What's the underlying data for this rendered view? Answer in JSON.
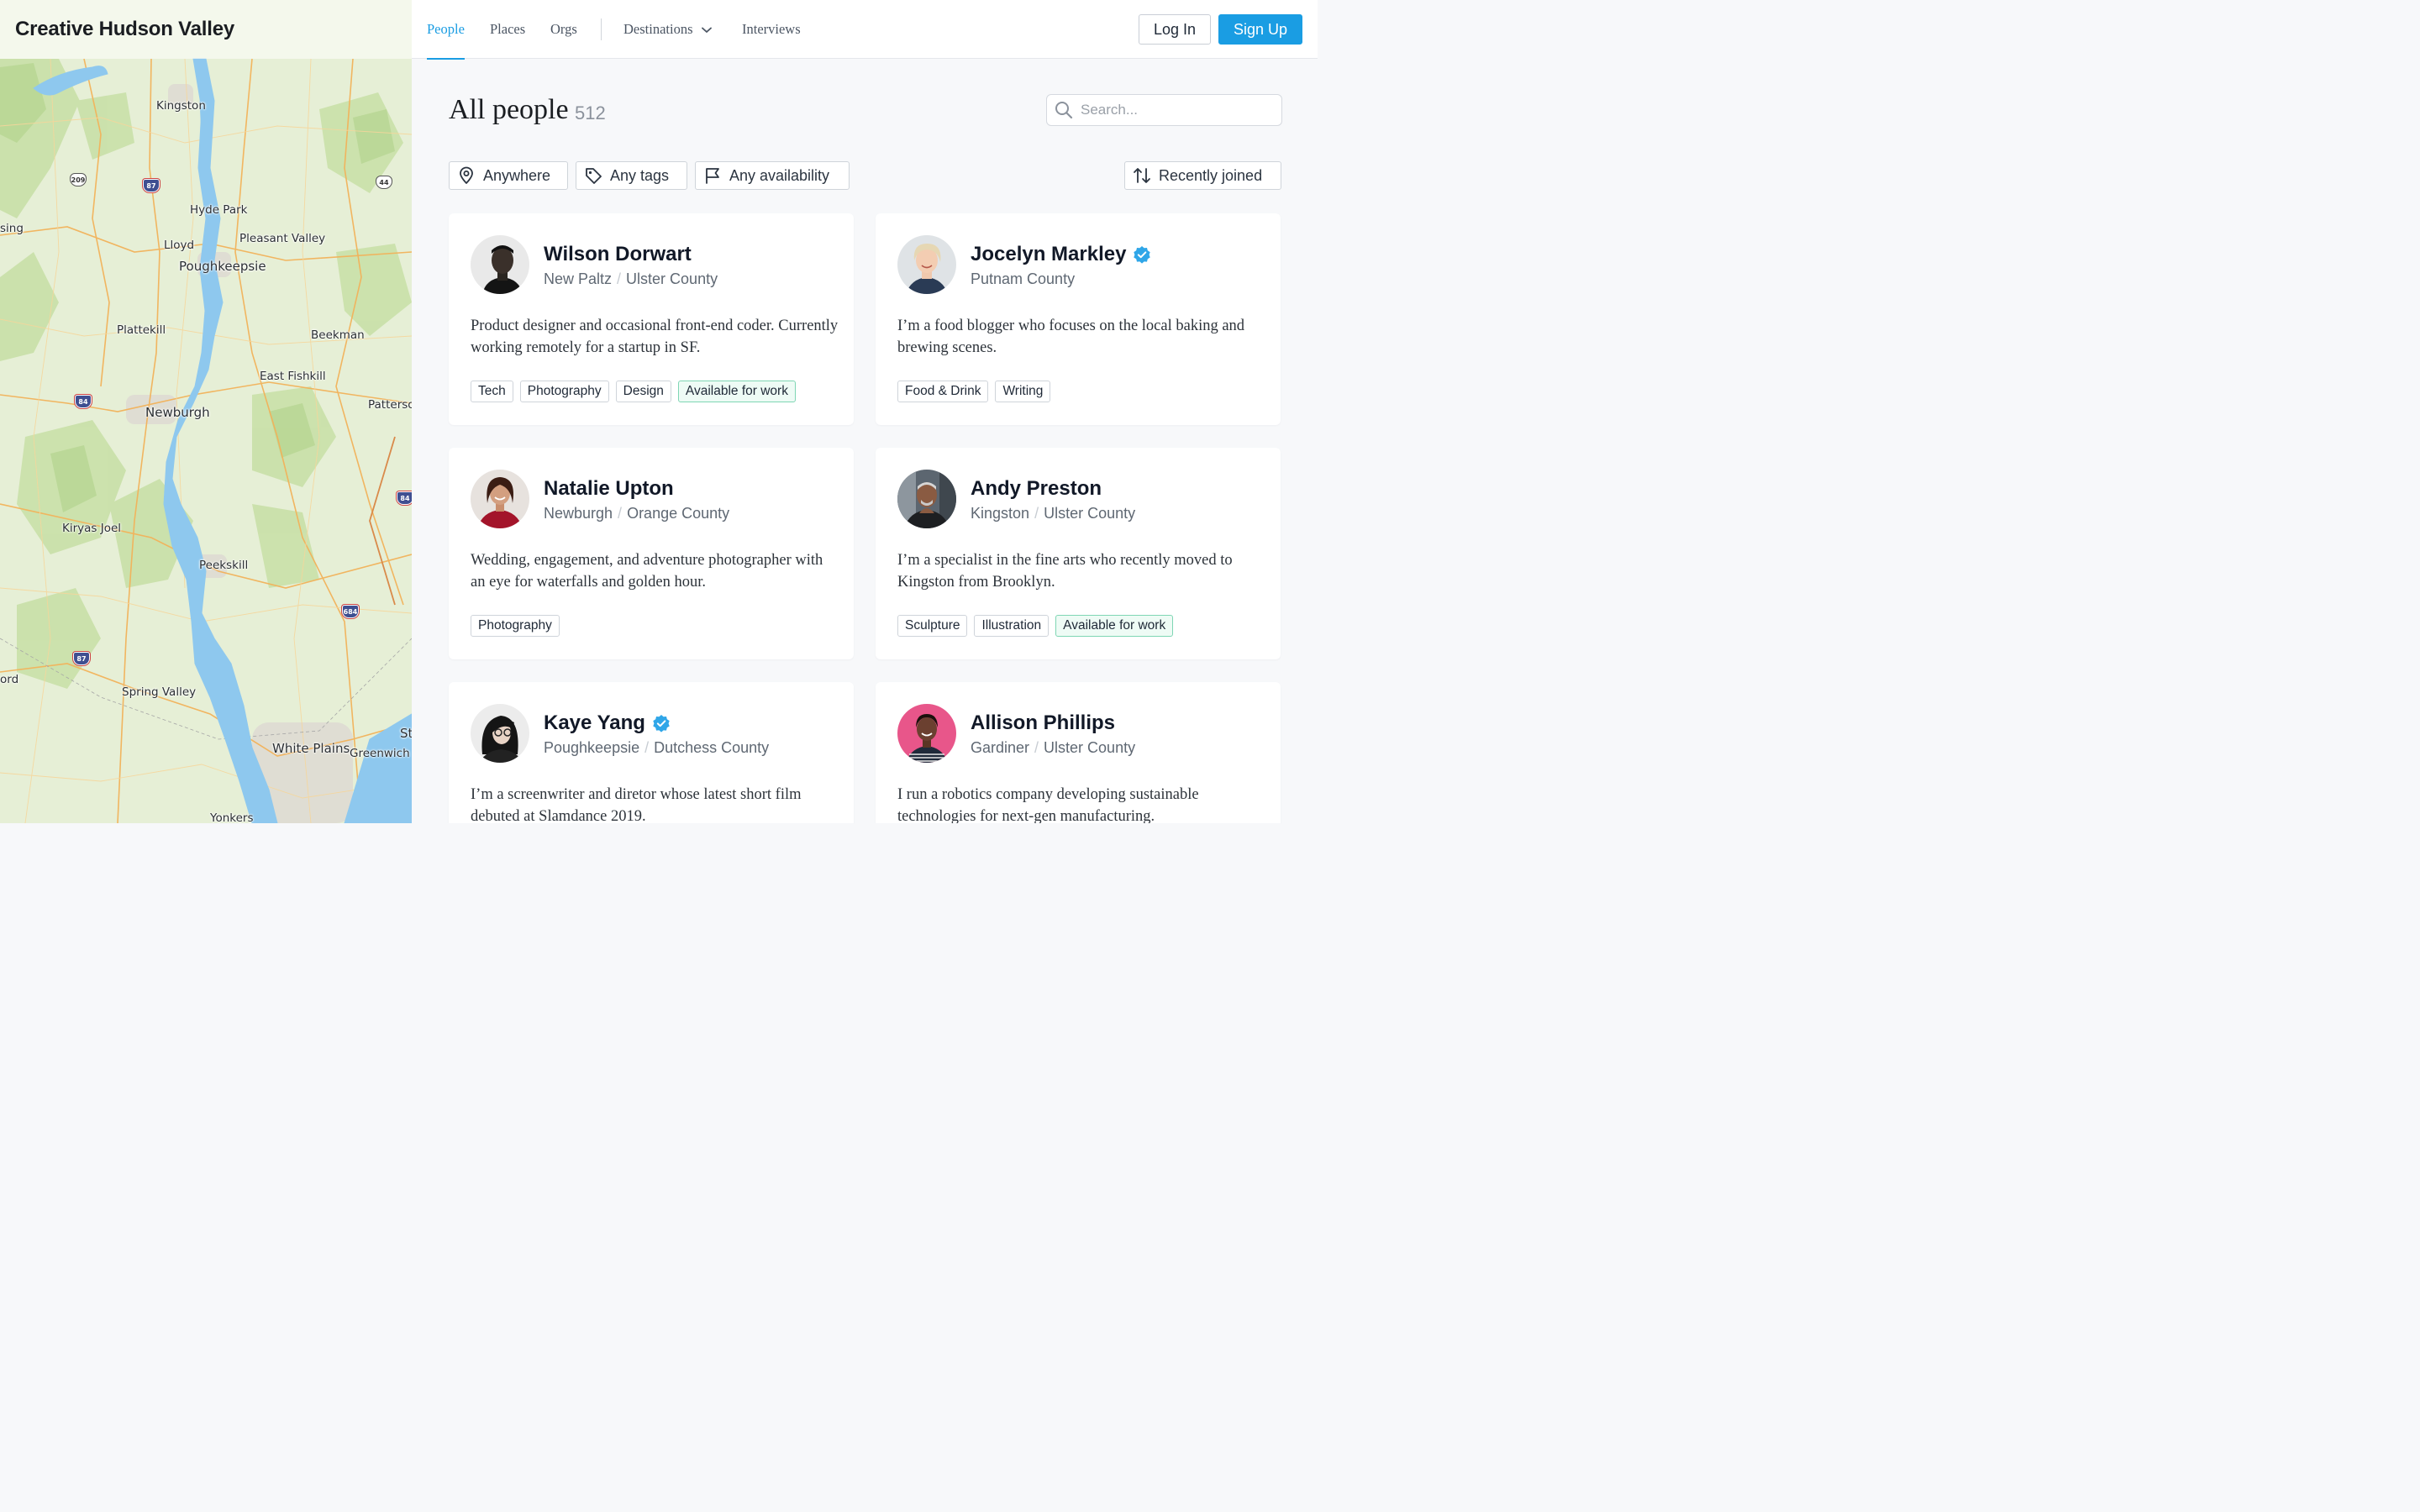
{
  "brand": {
    "title": "Creative Hudson Valley"
  },
  "nav": {
    "items": [
      "People",
      "Places",
      "Orgs"
    ],
    "destinations_label": "Destinations",
    "interviews_label": "Interviews",
    "login_label": "Log In",
    "signup_label": "Sign Up"
  },
  "page": {
    "title": "All people",
    "count": "512"
  },
  "search": {
    "placeholder": "Search...",
    "value": ""
  },
  "filters": {
    "location": "Anywhere",
    "tags": "Any tags",
    "availability": "Any availability",
    "sort": "Recently joined"
  },
  "map": {
    "labels": {
      "kingston": "Kingston",
      "hyde_park": "Hyde Park",
      "lloyd": "Lloyd",
      "pleasant_valley": "Pleasant Valley",
      "poughkeepsie": "Poughkeepsie",
      "plattekill": "Plattekill",
      "beekman": "Beekman",
      "east_fishkill": "East Fishkill",
      "newburgh": "Newburgh",
      "patterson": "Patterso",
      "kiryas_joel": "Kiryas Joel",
      "peekskill": "Peekskill",
      "spring_valley": "Spring Valley",
      "white_plains": "White Plains",
      "greenwich": "Greenwich",
      "yonkers": "Yonkers",
      "sing": "sing",
      "ord": "ord",
      "st": "St"
    },
    "shields": {
      "us209": "209",
      "i87a": "87",
      "us44": "44",
      "i84a": "84",
      "i84b": "84",
      "i684": "684",
      "i87b": "87"
    },
    "colors": {
      "water": "#8ec8ee",
      "land": "#e6efd6",
      "forest": "#c9e0a8",
      "road": "#f2b25a"
    }
  },
  "people": [
    {
      "name": "Wilson Dorwart",
      "verified": false,
      "town": "New Paltz",
      "county": "Ulster County",
      "bio": "Product designer and occasional front-end coder. Currently working remotely for a startup in SF.",
      "tags": [
        "Tech",
        "Photography",
        "Design"
      ],
      "available": "Available for work"
    },
    {
      "name": "Jocelyn Markley",
      "verified": true,
      "town": "",
      "county": "Putnam County",
      "bio": "I’m a food blogger who focuses on the local baking and brewing scenes.",
      "tags": [
        "Food & Drink",
        "Writing"
      ],
      "available": ""
    },
    {
      "name": "Natalie Upton",
      "verified": false,
      "town": "Newburgh",
      "county": "Orange County",
      "bio": "Wedding, engagement, and adventure photographer with an eye for waterfalls and golden hour.",
      "tags": [
        "Photography"
      ],
      "available": ""
    },
    {
      "name": "Andy Preston",
      "verified": false,
      "town": "Kingston",
      "county": "Ulster County",
      "bio": "I’m a specialist in the fine arts who recently moved to Kingston from Brooklyn.",
      "tags": [
        "Sculpture",
        "Illustration"
      ],
      "available": "Available for work"
    },
    {
      "name": "Kaye Yang",
      "verified": true,
      "town": "Poughkeepsie",
      "county": "Dutchess County",
      "bio": "I’m a screenwriter and diretor whose latest short film debuted at Slamdance 2019.",
      "tags": [],
      "available": ""
    },
    {
      "name": "Allison Phillips",
      "verified": false,
      "town": "Gardiner",
      "county": "Ulster County",
      "bio": "I run a robotics company developing sustainable technologies for next-gen manufacturing.",
      "tags": [],
      "available": ""
    }
  ],
  "icons": {
    "map_pin": "map-pin-icon",
    "tag": "tag-icon",
    "flag": "flag-icon",
    "sort": "sort-arrows-icon",
    "search": "search-icon",
    "verified": "verified-badge-icon",
    "chevron": "chevron-down-icon"
  },
  "colors": {
    "accent": "#1a9de3",
    "available_border": "#7fd6b4",
    "available_bg": "#eefbf5"
  }
}
